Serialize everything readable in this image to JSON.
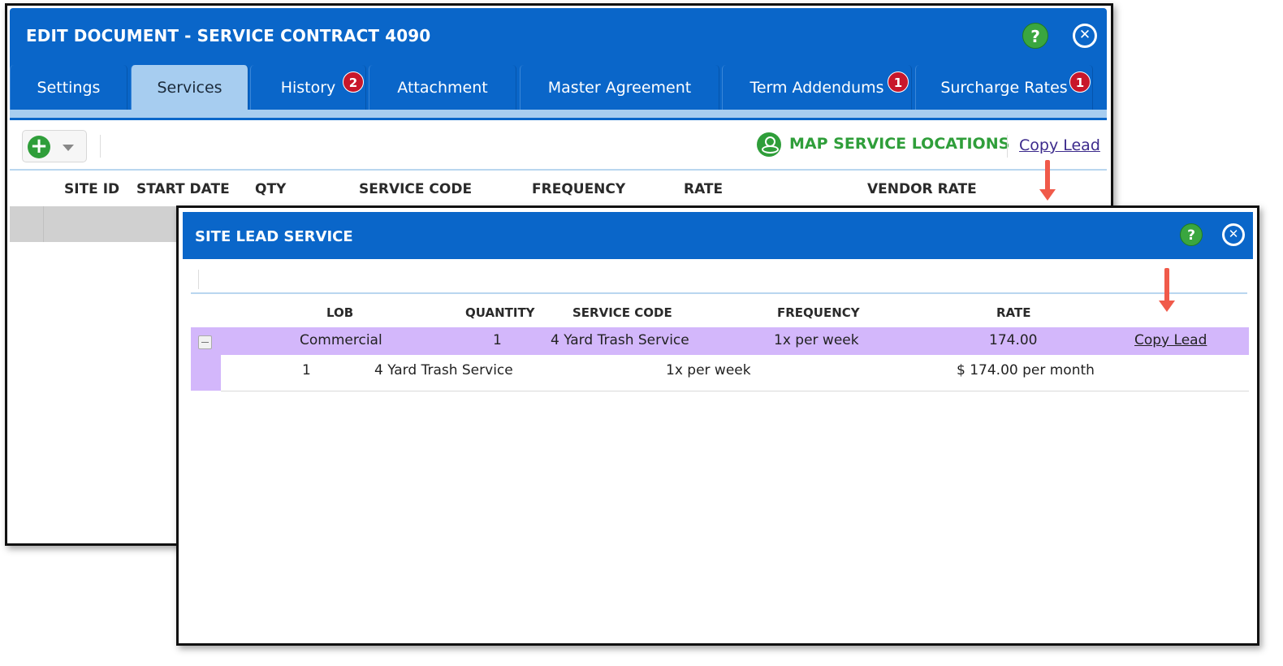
{
  "main_dialog": {
    "title": "EDIT DOCUMENT - SERVICE CONTRACT 4090",
    "help_label": "?",
    "tabs": [
      {
        "label": "Settings",
        "badge": ""
      },
      {
        "label": "Services",
        "badge": ""
      },
      {
        "label": "History",
        "badge": "2"
      },
      {
        "label": "Attachment",
        "badge": ""
      },
      {
        "label": "Master Agreement",
        "badge": ""
      },
      {
        "label": "Term Addendums",
        "badge": "1"
      },
      {
        "label": "Surcharge Rates",
        "badge": "1"
      }
    ],
    "active_tab": "Services",
    "toolbar": {
      "map_label": "MAP SERVICE LOCATIONS",
      "copy_lead": "Copy Lead"
    },
    "grid_columns": [
      "SITE ID",
      "START DATE",
      "QTY",
      "SERVICE CODE",
      "FREQUENCY",
      "RATE",
      "VENDOR RATE"
    ]
  },
  "lead_dialog": {
    "title": "SITE LEAD SERVICE",
    "help_label": "?",
    "columns": [
      "LOB",
      "QUANTITY",
      "SERVICE CODE",
      "FREQUENCY",
      "RATE"
    ],
    "row": {
      "lob": "Commercial",
      "quantity": "1",
      "service_code": "4 Yard Trash Service",
      "frequency": "1x per week",
      "rate": "174.00",
      "action": "Copy Lead"
    },
    "detail": {
      "quantity": "1",
      "service_code": "4 Yard Trash Service",
      "frequency": "1x per week",
      "price": "$ 174.00 per month"
    }
  },
  "colors": {
    "header_blue": "#0a66c9",
    "tab_active": "#a7cdf0",
    "badge_red": "#c8172b",
    "accent_green": "#2f9e3a",
    "row_highlight": "#d3b7fb",
    "arrow": "#f05a4a"
  }
}
